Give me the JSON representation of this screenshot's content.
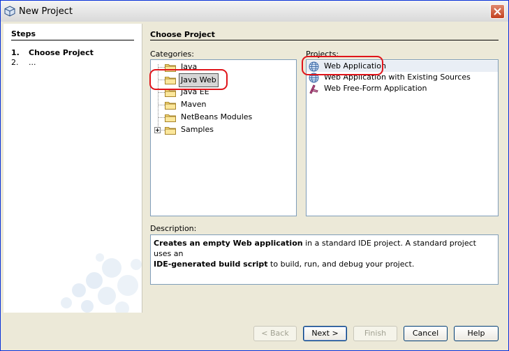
{
  "window": {
    "title": "New Project",
    "close_icon": "close-icon"
  },
  "steps": {
    "title": "Steps",
    "items": [
      {
        "num": "1.",
        "label": "Choose Project",
        "bold": true
      },
      {
        "num": "2.",
        "label": "...",
        "bold": false
      }
    ]
  },
  "main": {
    "title": "Choose Project"
  },
  "categories": {
    "label": "Categories:",
    "items": [
      {
        "label": "Java"
      },
      {
        "label": "Java Web",
        "selected": true
      },
      {
        "label": "Java EE"
      },
      {
        "label": "Maven"
      },
      {
        "label": "NetBeans Modules"
      },
      {
        "label": "Samples",
        "expandable": true
      }
    ]
  },
  "projects": {
    "label": "Projects:",
    "items": [
      {
        "label": "Web Application",
        "icon": "globe-icon",
        "selected": true
      },
      {
        "label": "Web Application with Existing Sources",
        "icon": "globe-icon"
      },
      {
        "label": "Web Free-Form Application",
        "icon": "freeform-icon"
      }
    ]
  },
  "description": {
    "label": "Description:",
    "bold1": "Creates an empty Web application",
    "text1": " in a standard IDE project. A standard project uses an",
    "bold2": "IDE-generated build script",
    "text2": " to build, run, and debug your project."
  },
  "buttons": {
    "back": "< Back",
    "next": "Next >",
    "finish": "Finish",
    "cancel": "Cancel",
    "help": "Help"
  },
  "colors": {
    "selection_outline": "#e0141a",
    "title_bar": "#e3e3e3",
    "panel_bg": "#ece9d8"
  }
}
